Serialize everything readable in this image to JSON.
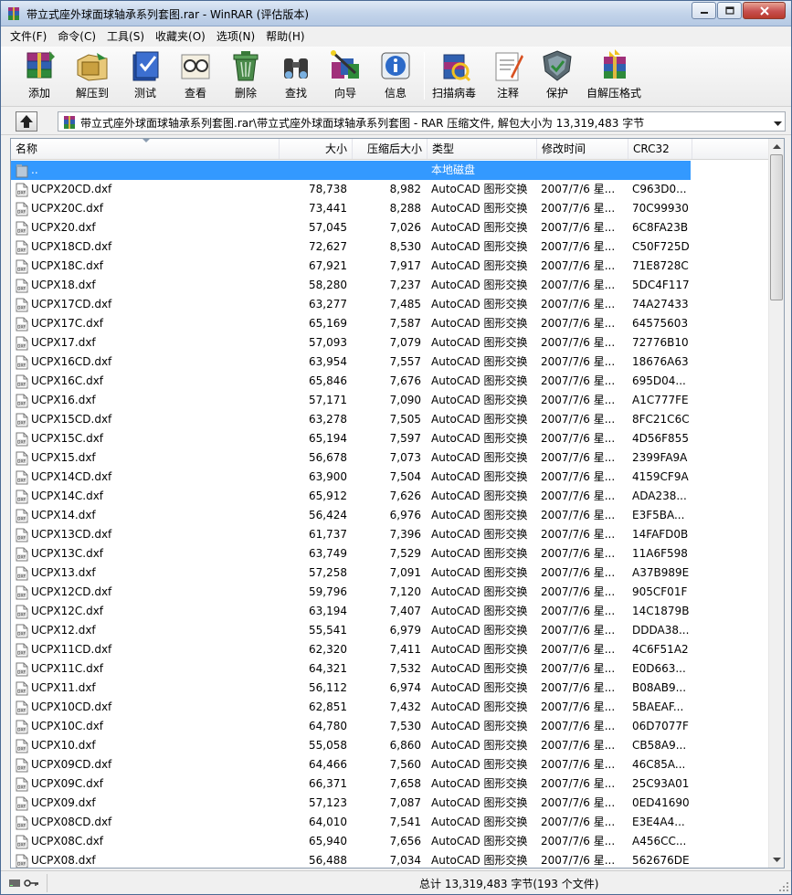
{
  "window": {
    "title": "带立式座外球面球轴承系列套图.rar - WinRAR (评估版本)"
  },
  "menu": [
    "文件(F)",
    "命令(C)",
    "工具(S)",
    "收藏夹(O)",
    "选项(N)",
    "帮助(H)"
  ],
  "toolbar": {
    "buttons": [
      {
        "label": "添加",
        "icon": "archive-add-icon"
      },
      {
        "label": "解压到",
        "icon": "extract-to-icon"
      },
      {
        "label": "测试",
        "icon": "test-icon"
      },
      {
        "label": "查看",
        "icon": "view-icon"
      },
      {
        "label": "删除",
        "icon": "delete-icon"
      },
      {
        "label": "查找",
        "icon": "find-icon"
      },
      {
        "label": "向导",
        "icon": "wizard-icon"
      },
      {
        "label": "信息",
        "icon": "info-icon"
      },
      {
        "label": "扫描病毒",
        "icon": "virus-scan-icon"
      },
      {
        "label": "注释",
        "icon": "comment-icon"
      },
      {
        "label": "保护",
        "icon": "protect-icon"
      },
      {
        "label": "自解压格式",
        "icon": "sfx-icon"
      }
    ]
  },
  "address": {
    "path": "带立式座外球面球轴承系列套图.rar\\带立式座外球面球轴承系列套图 - RAR 压缩文件, 解包大小为 13,319,483 字节"
  },
  "columns": {
    "name": "名称",
    "size": "大小",
    "packed": "压缩后大小",
    "type": "类型",
    "modified": "修改时间",
    "crc": "CRC32"
  },
  "parent_row": {
    "name": "..",
    "type": "本地磁盘"
  },
  "files": [
    {
      "name": "UCPX20CD.dxf",
      "size": "78,738",
      "packed": "8,982",
      "type": "AutoCAD 图形交换",
      "modified": "2007/7/6 星...",
      "crc": "C963D0..."
    },
    {
      "name": "UCPX20C.dxf",
      "size": "73,441",
      "packed": "8,288",
      "type": "AutoCAD 图形交换",
      "modified": "2007/7/6 星...",
      "crc": "70C99930"
    },
    {
      "name": "UCPX20.dxf",
      "size": "57,045",
      "packed": "7,026",
      "type": "AutoCAD 图形交换",
      "modified": "2007/7/6 星...",
      "crc": "6C8FA23B"
    },
    {
      "name": "UCPX18CD.dxf",
      "size": "72,627",
      "packed": "8,530",
      "type": "AutoCAD 图形交换",
      "modified": "2007/7/6 星...",
      "crc": "C50F725D"
    },
    {
      "name": "UCPX18C.dxf",
      "size": "67,921",
      "packed": "7,917",
      "type": "AutoCAD 图形交换",
      "modified": "2007/7/6 星...",
      "crc": "71E8728C"
    },
    {
      "name": "UCPX18.dxf",
      "size": "58,280",
      "packed": "7,237",
      "type": "AutoCAD 图形交换",
      "modified": "2007/7/6 星...",
      "crc": "5DC4F117"
    },
    {
      "name": "UCPX17CD.dxf",
      "size": "63,277",
      "packed": "7,485",
      "type": "AutoCAD 图形交换",
      "modified": "2007/7/6 星...",
      "crc": "74A27433"
    },
    {
      "name": "UCPX17C.dxf",
      "size": "65,169",
      "packed": "7,587",
      "type": "AutoCAD 图形交换",
      "modified": "2007/7/6 星...",
      "crc": "64575603"
    },
    {
      "name": "UCPX17.dxf",
      "size": "57,093",
      "packed": "7,079",
      "type": "AutoCAD 图形交换",
      "modified": "2007/7/6 星...",
      "crc": "72776B10"
    },
    {
      "name": "UCPX16CD.dxf",
      "size": "63,954",
      "packed": "7,557",
      "type": "AutoCAD 图形交换",
      "modified": "2007/7/6 星...",
      "crc": "18676A63"
    },
    {
      "name": "UCPX16C.dxf",
      "size": "65,846",
      "packed": "7,676",
      "type": "AutoCAD 图形交换",
      "modified": "2007/7/6 星...",
      "crc": "695D04..."
    },
    {
      "name": "UCPX16.dxf",
      "size": "57,171",
      "packed": "7,090",
      "type": "AutoCAD 图形交换",
      "modified": "2007/7/6 星...",
      "crc": "A1C777FE"
    },
    {
      "name": "UCPX15CD.dxf",
      "size": "63,278",
      "packed": "7,505",
      "type": "AutoCAD 图形交换",
      "modified": "2007/7/6 星...",
      "crc": "8FC21C6C"
    },
    {
      "name": "UCPX15C.dxf",
      "size": "65,194",
      "packed": "7,597",
      "type": "AutoCAD 图形交换",
      "modified": "2007/7/6 星...",
      "crc": "4D56F855"
    },
    {
      "name": "UCPX15.dxf",
      "size": "56,678",
      "packed": "7,073",
      "type": "AutoCAD 图形交换",
      "modified": "2007/7/6 星...",
      "crc": "2399FA9A"
    },
    {
      "name": "UCPX14CD.dxf",
      "size": "63,900",
      "packed": "7,504",
      "type": "AutoCAD 图形交换",
      "modified": "2007/7/6 星...",
      "crc": "4159CF9A"
    },
    {
      "name": "UCPX14C.dxf",
      "size": "65,912",
      "packed": "7,626",
      "type": "AutoCAD 图形交换",
      "modified": "2007/7/6 星...",
      "crc": "ADA238..."
    },
    {
      "name": "UCPX14.dxf",
      "size": "56,424",
      "packed": "6,976",
      "type": "AutoCAD 图形交换",
      "modified": "2007/7/6 星...",
      "crc": "E3F5BA..."
    },
    {
      "name": "UCPX13CD.dxf",
      "size": "61,737",
      "packed": "7,396",
      "type": "AutoCAD 图形交换",
      "modified": "2007/7/6 星...",
      "crc": "14FAFD0B"
    },
    {
      "name": "UCPX13C.dxf",
      "size": "63,749",
      "packed": "7,529",
      "type": "AutoCAD 图形交换",
      "modified": "2007/7/6 星...",
      "crc": "11A6F598"
    },
    {
      "name": "UCPX13.dxf",
      "size": "57,258",
      "packed": "7,091",
      "type": "AutoCAD 图形交换",
      "modified": "2007/7/6 星...",
      "crc": "A37B989E"
    },
    {
      "name": "UCPX12CD.dxf",
      "size": "59,796",
      "packed": "7,120",
      "type": "AutoCAD 图形交换",
      "modified": "2007/7/6 星...",
      "crc": "905CF01F"
    },
    {
      "name": "UCPX12C.dxf",
      "size": "63,194",
      "packed": "7,407",
      "type": "AutoCAD 图形交换",
      "modified": "2007/7/6 星...",
      "crc": "14C1879B"
    },
    {
      "name": "UCPX12.dxf",
      "size": "55,541",
      "packed": "6,979",
      "type": "AutoCAD 图形交换",
      "modified": "2007/7/6 星...",
      "crc": "DDDA38..."
    },
    {
      "name": "UCPX11CD.dxf",
      "size": "62,320",
      "packed": "7,411",
      "type": "AutoCAD 图形交换",
      "modified": "2007/7/6 星...",
      "crc": "4C6F51A2"
    },
    {
      "name": "UCPX11C.dxf",
      "size": "64,321",
      "packed": "7,532",
      "type": "AutoCAD 图形交换",
      "modified": "2007/7/6 星...",
      "crc": "E0D663..."
    },
    {
      "name": "UCPX11.dxf",
      "size": "56,112",
      "packed": "6,974",
      "type": "AutoCAD 图形交换",
      "modified": "2007/7/6 星...",
      "crc": "B08AB9..."
    },
    {
      "name": "UCPX10CD.dxf",
      "size": "62,851",
      "packed": "7,432",
      "type": "AutoCAD 图形交换",
      "modified": "2007/7/6 星...",
      "crc": "5BAEAF..."
    },
    {
      "name": "UCPX10C.dxf",
      "size": "64,780",
      "packed": "7,530",
      "type": "AutoCAD 图形交换",
      "modified": "2007/7/6 星...",
      "crc": "06D7077F"
    },
    {
      "name": "UCPX10.dxf",
      "size": "55,058",
      "packed": "6,860",
      "type": "AutoCAD 图形交换",
      "modified": "2007/7/6 星...",
      "crc": "CB58A9..."
    },
    {
      "name": "UCPX09CD.dxf",
      "size": "64,466",
      "packed": "7,560",
      "type": "AutoCAD 图形交换",
      "modified": "2007/7/6 星...",
      "crc": "46C85A..."
    },
    {
      "name": "UCPX09C.dxf",
      "size": "66,371",
      "packed": "7,658",
      "type": "AutoCAD 图形交换",
      "modified": "2007/7/6 星...",
      "crc": "25C93A01"
    },
    {
      "name": "UCPX09.dxf",
      "size": "57,123",
      "packed": "7,087",
      "type": "AutoCAD 图形交换",
      "modified": "2007/7/6 星...",
      "crc": "0ED41690"
    },
    {
      "name": "UCPX08CD.dxf",
      "size": "64,010",
      "packed": "7,541",
      "type": "AutoCAD 图形交换",
      "modified": "2007/7/6 星...",
      "crc": "E3E4A4..."
    },
    {
      "name": "UCPX08C.dxf",
      "size": "65,940",
      "packed": "7,656",
      "type": "AutoCAD 图形交换",
      "modified": "2007/7/6 星...",
      "crc": "A456CC..."
    },
    {
      "name": "UCPX08.dxf",
      "size": "56,488",
      "packed": "7,034",
      "type": "AutoCAD 图形交换",
      "modified": "2007/7/6 星...",
      "crc": "562676DE"
    }
  ],
  "status": {
    "summary": "总计 13,319,483 字节(193 个文件)"
  },
  "colors": {
    "selection": "#3399ff"
  }
}
